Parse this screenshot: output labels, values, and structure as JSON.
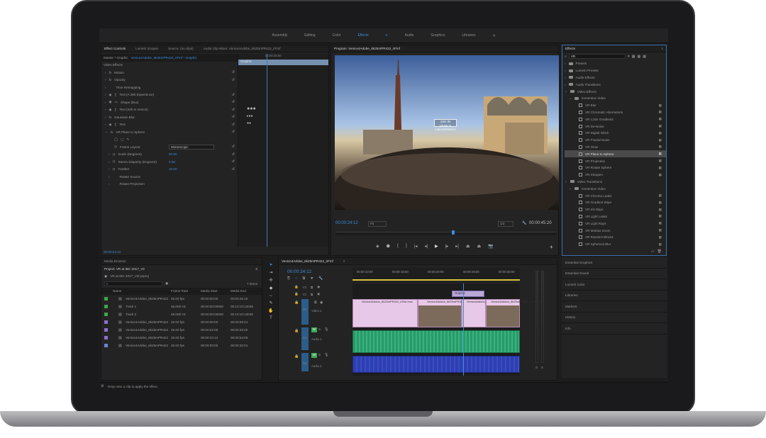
{
  "workspace_tabs": [
    "Assembly",
    "Editing",
    "Color",
    "Effects",
    "Audio",
    "Graphics",
    "Libraries"
  ],
  "active_workspace": "Effects",
  "more_icon": "»",
  "effect_controls": {
    "tabs": [
      "Effect Controls",
      "Lumetri Scopes",
      "Source: (no clips)",
      "Audio Clip Mixer: Venice4Adobe_6k25mPR422_irFinf"
    ],
    "master_label": "Master * Graphic",
    "clip_label": "Venice4Adobe_6k25mPR422_irFinf * Graphic",
    "timeline_time": "00:00:25:00",
    "graphic_label": "Graphic",
    "video_effects_label": "Video Effects",
    "rows": [
      "Motion",
      "Opacity",
      "Time Remapping",
      "Text (A 360 Experience)",
      "Shape (Box)",
      "Text (24h in Venice)",
      "Gaussian Blur",
      "Text",
      "VR Plane to Sphere"
    ],
    "sub_rows": [
      {
        "label": "Frame Layout",
        "value": "Monoscopic"
      },
      {
        "label": "Scale (Degrees)",
        "value": "60.00"
      },
      {
        "label": "Stereo Disparity (Degrees)",
        "value": "0.00"
      },
      {
        "label": "Feather",
        "value": "10.00"
      },
      {
        "label": "Rotate Source",
        "value": ""
      },
      {
        "label": "Rotate Projection",
        "value": ""
      }
    ],
    "timecode": "00:00:24:12"
  },
  "program": {
    "title": "Program: Venice4Adobe_6k25mPR422_irFinf",
    "overlay_title": "24H IN VENICE",
    "overlay_sub": "A 360 EXPERIENCE",
    "timecode": "00:00:24:12",
    "fit": "Fit",
    "scale": "1/2",
    "duration": "00:00:45:20"
  },
  "effects_panel": {
    "title": "Effects",
    "search": "VR",
    "folders": [
      "Presets",
      "Lumetri Presets",
      "Audio Effects",
      "Audio Transitions",
      "Video Effects"
    ],
    "immersive_video_label": "Immersive Video",
    "video_effects": [
      "VR Blur",
      "VR Chromatic Aberrations",
      "VR Color Gradients",
      "VR De-Noise",
      "VR Digital Glitch",
      "VR Fractal Noise",
      "VR Glow",
      "VR Plane to Sphere",
      "VR Projection",
      "VR Rotate Sphere",
      "VR Sharpen"
    ],
    "video_transitions_label": "Video Transitions",
    "immersive_video_label2": "Immersive Video",
    "transitions": [
      "VR Chroma Leaks",
      "VR Gradient Wipe",
      "VR Iris Wipe",
      "VR Light Leaks",
      "VR Light Rays",
      "VR Mobius Zoom",
      "VR Random Blocks",
      "VR Spherical Blur"
    ],
    "selected": "VR Plane to Sphere"
  },
  "side_panels": [
    "Essential Graphics",
    "Essential Sound",
    "Lumetri Color",
    "Libraries",
    "Markers",
    "History",
    "Info"
  ],
  "media_browser": {
    "tab": "Media Browser",
    "project_title": "Project: VR at IBC 2017_V2",
    "project_file": "VR at IBC 2017_V2r.prproj",
    "items_count": "7 Items",
    "columns": [
      "Name",
      "Frame Rate",
      "Media Start",
      "Media End"
    ],
    "rows": [
      {
        "name": "Venice4Adobe_6k25mPR422",
        "rate": "25.00 fps",
        "start": "00:00:00:00",
        "end": "00:00:45:19",
        "color": "#3aa64a"
      },
      {
        "name": "Track 1",
        "rate": "48,000 Hz",
        "start": "00:00:00:00000",
        "end": "00:10:10:12045",
        "color": "#3aa64a"
      },
      {
        "name": "Track 2",
        "rate": "48,000 Hz",
        "start": "00:00:00:00000",
        "end": "00:10:10:12045",
        "color": "#3aa64a"
      },
      {
        "name": "Venice4Adobe_6k25mPR422",
        "rate": "25.00 fps",
        "start": "00:00:00:00",
        "end": "00:00:09:24",
        "color": "#8a6fd1"
      },
      {
        "name": "Venice4Adobe_6k25mPR422",
        "rate": "25.00 fps",
        "start": "00:00:22:06",
        "end": "00:00:33:20",
        "color": "#8a6fd1"
      },
      {
        "name": "Venice4Adobe_6k25mPR422",
        "rate": "25.00 fps",
        "start": "00:00:34:12",
        "end": "00:00:54:06",
        "color": "#8a6fd1"
      },
      {
        "name": "Venice4Adobe_6k25mPR422",
        "rate": "25.00 fps",
        "start": "00:00:00:00",
        "end": "00:00:20:01",
        "color": "#6a85d8"
      }
    ]
  },
  "timeline": {
    "title": "Venice4Adobe_6k25mPR422_irFinf",
    "timecode": "00:00:24:12",
    "ruler": [
      "00:00:10:00",
      "00:00:15:00",
      "00:00:20:00",
      "00:00:25:00",
      "00:00:30:00"
    ],
    "tracks": [
      "V3",
      "V2",
      "V1",
      "A1",
      "A2"
    ],
    "video1_label": "Video 1",
    "audio1_label": "Audio 1",
    "audio2_label": "Audio 2",
    "graphic_clip": "Graphic",
    "clip_names": [
      "Venice4Adobe_6k25mPR422_irFinf.mov",
      "Venice4Adobe_6k25mPR422_irFinf.mov",
      "Venice4Adobe_6k25mPR422_irFinf.mov",
      "Venice4Adobe_6k25mPR422_irFinf.mov"
    ]
  },
  "status_bar": "Drop onto a clip to apply the effect.",
  "meter_labels": [
    "S",
    "S"
  ]
}
